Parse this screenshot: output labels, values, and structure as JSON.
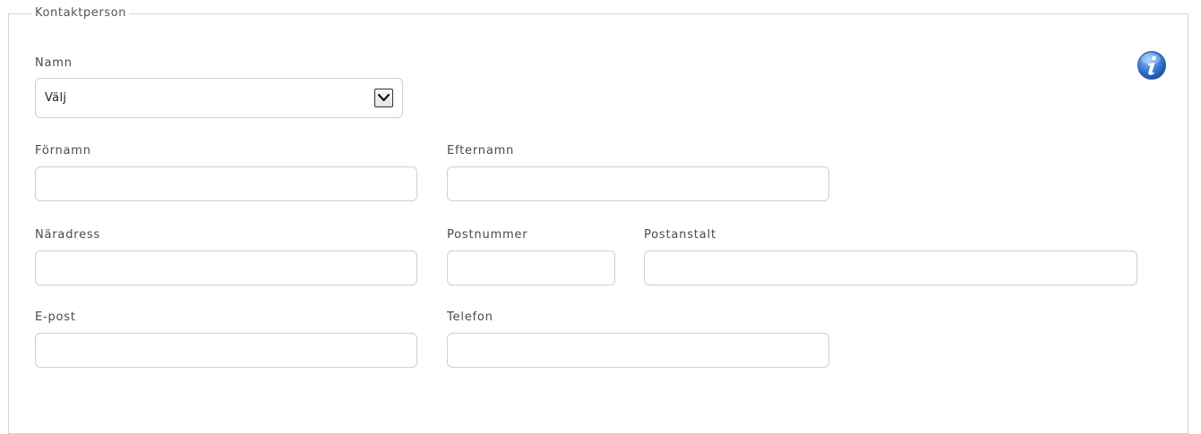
{
  "section": {
    "legend": "Kontaktperson"
  },
  "name_select": {
    "label": "Namn",
    "selected": "Välj"
  },
  "fields": {
    "first_name": {
      "label": "Förnamn",
      "value": ""
    },
    "last_name": {
      "label": "Efternamn",
      "value": ""
    },
    "address": {
      "label": "Näradress",
      "value": ""
    },
    "postal_code": {
      "label": "Postnummer",
      "value": ""
    },
    "city": {
      "label": "Postanstalt",
      "value": ""
    },
    "email": {
      "label": "E-post",
      "value": ""
    },
    "phone": {
      "label": "Telefon",
      "value": ""
    }
  },
  "icons": {
    "info": "info-icon",
    "dropdown": "chevron-down-icon"
  },
  "colors": {
    "info_blue": "#3f7fd6",
    "border": "#cfcfcf"
  }
}
